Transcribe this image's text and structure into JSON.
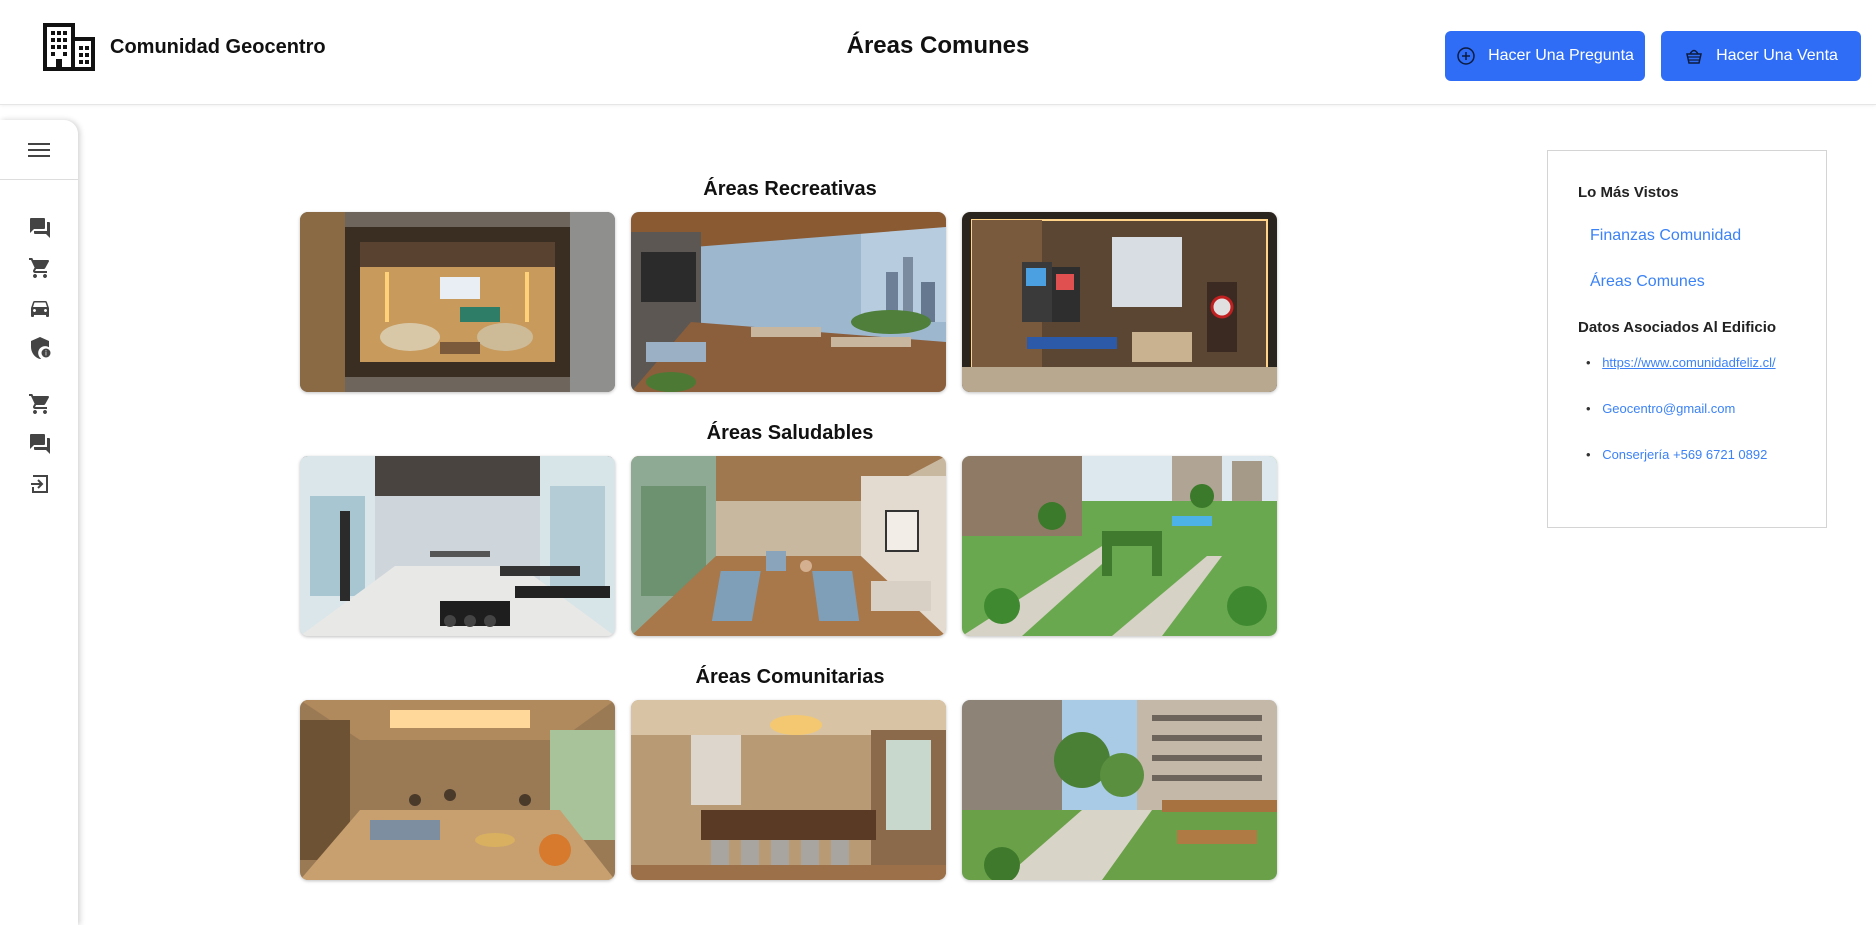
{
  "header": {
    "brand_name": "Comunidad Geocentro",
    "brand_icon": "building-icon",
    "title": "Áreas Comunes",
    "ask_button": "Hacer Una Pregunta",
    "sell_button": "Hacer Una Venta"
  },
  "sidebar": {
    "icons": [
      "menu-icon",
      "forum-icon",
      "cart-icon",
      "car-icon",
      "security-shield-icon",
      "cart-icon",
      "forum-icon",
      "logout-icon"
    ]
  },
  "sections": [
    {
      "title": "Áreas Recreativas",
      "images": [
        "lounge-room",
        "rooftop-terrace",
        "game-room"
      ]
    },
    {
      "title": "Áreas Saludables",
      "images": [
        "gym",
        "yoga-room",
        "green-park"
      ]
    },
    {
      "title": "Áreas Comunitarias",
      "images": [
        "community-lounge",
        "dining-hall",
        "outdoor-garden"
      ]
    }
  ],
  "panel": {
    "most_viewed_heading": "Lo Más Vistos",
    "most_viewed": [
      "Finanzas Comunidad",
      "Áreas Comunes"
    ],
    "building_heading": "Datos Asociados Al Edificio",
    "building_items": [
      "https://www.comunidadfeliz.cl/",
      "Geocentro@gmail.com",
      "Conserjería +569 6721 0892"
    ]
  },
  "colors": {
    "accent": "#2f6df6",
    "link": "#3b82f6"
  }
}
